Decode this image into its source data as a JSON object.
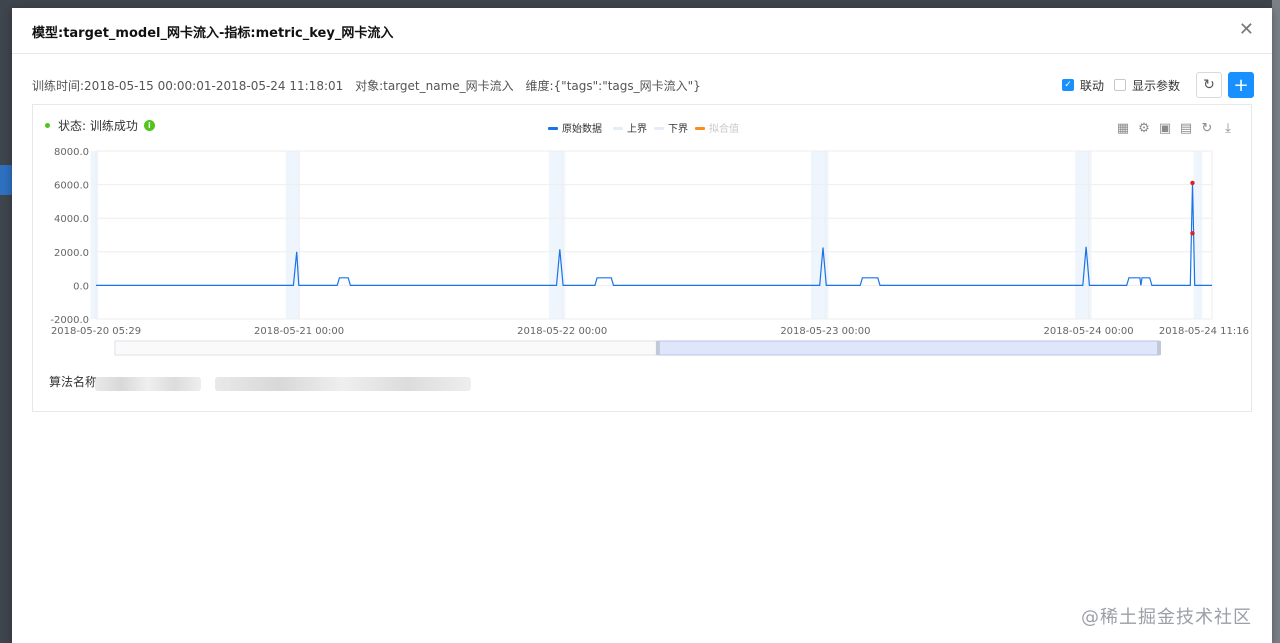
{
  "modal": {
    "title": "模型:target_model_网卡流入-指标:metric_key_网卡流入",
    "close_glyph": "✕"
  },
  "info": {
    "train_time": "训练时间:2018-05-15 00:00:01-2018-05-24 11:18:01",
    "object": "对象:target_name_网卡流入",
    "dimension": "维度:{\"tags\":\"tags_网卡流入\"}"
  },
  "controls": {
    "link_label": "联动",
    "link_checked": true,
    "show_params_label": "显示参数",
    "show_params_checked": false,
    "refresh_icon": "refresh-icon",
    "add_icon": "plus-icon",
    "add_glyph": "+",
    "refresh_glyph": "↻"
  },
  "status": {
    "text": "状态: 训练成功",
    "info_glyph": "i"
  },
  "toolbox": [
    "table-icon",
    "gear-icon",
    "save-icon",
    "document-icon",
    "refresh-icon",
    "download-icon"
  ],
  "algo_label": "算法名称",
  "watermark": "@稀土掘金技术社区",
  "chart_data": {
    "type": "line",
    "legend": [
      "原始数据",
      "上界",
      "下界",
      "拟合值"
    ],
    "legend_colors": [
      "#1a73e8",
      "#e3ecf9",
      "#e3ecf9",
      "#ff8c1a"
    ],
    "y_ticks": [
      "8000.0",
      "6000.0",
      "4000.0",
      "2000.0",
      "0.0",
      "-2000.0"
    ],
    "ylim": [
      -2000,
      8000
    ],
    "x_ticks": [
      "2018-05-20 05:29",
      "2018-05-21 00:00",
      "2018-05-22 00:00",
      "2018-05-23 00:00",
      "2018-05-24 00:00",
      "2018-05-24 11:16"
    ],
    "x_tick_hours": [
      0,
      18.52,
      42.52,
      66.52,
      90.52,
      101.78
    ],
    "x_range_hours": [
      0,
      101.78
    ],
    "series": [
      {
        "name": "原始数据",
        "points": [
          [
            0,
            0
          ],
          [
            18.0,
            0
          ],
          [
            18.3,
            2000
          ],
          [
            18.5,
            0
          ],
          [
            22.0,
            0
          ],
          [
            22.2,
            450
          ],
          [
            23.0,
            450
          ],
          [
            23.2,
            0
          ],
          [
            42.0,
            0
          ],
          [
            42.3,
            2150
          ],
          [
            42.6,
            0
          ],
          [
            45.5,
            0
          ],
          [
            45.7,
            450
          ],
          [
            47.0,
            450
          ],
          [
            47.2,
            0
          ],
          [
            66.0,
            0
          ],
          [
            66.3,
            2250
          ],
          [
            66.6,
            0
          ],
          [
            69.7,
            0
          ],
          [
            69.9,
            450
          ],
          [
            71.3,
            450
          ],
          [
            71.5,
            0
          ],
          [
            90.0,
            0
          ],
          [
            90.3,
            2300
          ],
          [
            90.6,
            0
          ],
          [
            94.0,
            0
          ],
          [
            94.2,
            450
          ],
          [
            95.2,
            450
          ],
          [
            95.3,
            0
          ],
          [
            95.4,
            450
          ],
          [
            96.1,
            450
          ],
          [
            96.3,
            0
          ],
          [
            99.8,
            0
          ],
          [
            100.0,
            6100
          ],
          [
            100.1,
            3100
          ],
          [
            100.2,
            0
          ],
          [
            101.78,
            0
          ]
        ]
      }
    ],
    "anomaly_points": [
      [
        100.0,
        6100
      ],
      [
        100.0,
        3100
      ]
    ],
    "band_hours": [
      [
        -0.5,
        0.2
      ],
      [
        17.3,
        18.6
      ],
      [
        41.3,
        42.8
      ],
      [
        65.2,
        66.8
      ],
      [
        89.3,
        90.8
      ],
      [
        100.1,
        100.9
      ]
    ],
    "zoom_window": [
      0.52,
      1.0
    ]
  }
}
